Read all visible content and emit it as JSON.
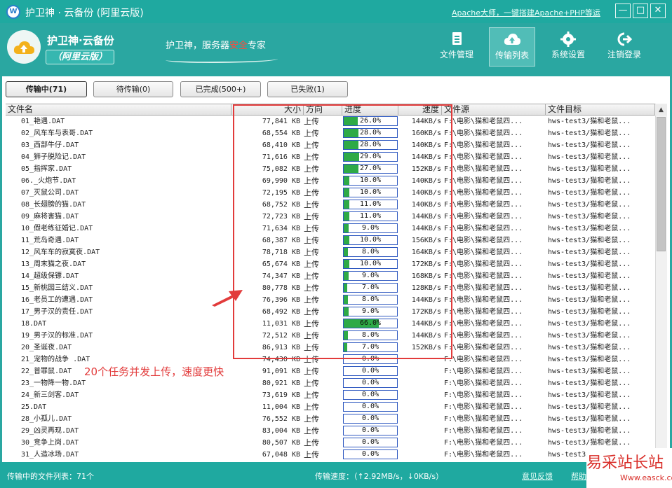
{
  "window": {
    "title": "护卫神 · 云备份 (阿里云版)",
    "top_link": "Apache大师，一键搭建Apache+PHP等运",
    "controls": [
      "—",
      "□",
      "✕"
    ]
  },
  "brand": {
    "name": "护卫神·云备份",
    "edition": "（阿里云版）",
    "slogan_prefix": "护卫神，服务器",
    "slogan_highlight": "安全",
    "slogan_suffix": "专家"
  },
  "nav": [
    {
      "label": "文件管理",
      "icon": "file-icon",
      "active": false
    },
    {
      "label": "传输列表",
      "icon": "cloud-upload-icon",
      "active": true
    },
    {
      "label": "系统设置",
      "icon": "gear-icon",
      "active": false
    },
    {
      "label": "注销登录",
      "icon": "logout-icon",
      "active": false
    }
  ],
  "tabs": [
    {
      "label": "传输中(71)",
      "active": true
    },
    {
      "label": "待传输(0)",
      "active": false
    },
    {
      "label": "已完成(500+)",
      "active": false
    },
    {
      "label": "已失败(1)",
      "active": false
    }
  ],
  "columns": [
    "文件名",
    "大小",
    "方向",
    "进度",
    "速度",
    "文件源",
    "文件目标"
  ],
  "rows": [
    {
      "name": "01_艳遇.DAT",
      "size": "77,841 KB",
      "dir": "上传",
      "progress": 26.0,
      "progress_text": "26.0%",
      "speed": "144KB/s",
      "src": "F:\\电影\\猫和老鼠四...",
      "dst": "hws-test3/猫和老鼠..."
    },
    {
      "name": "02_风车车与表哥.DAT",
      "size": "68,554 KB",
      "dir": "上传",
      "progress": 28.0,
      "progress_text": "28.0%",
      "speed": "160KB/s",
      "src": "F:\\电影\\猫和老鼠四...",
      "dst": "hws-test3/猫和老鼠..."
    },
    {
      "name": "03_西部牛仔.DAT",
      "size": "68,410 KB",
      "dir": "上传",
      "progress": 28.0,
      "progress_text": "28.0%",
      "speed": "140KB/s",
      "src": "F:\\电影\\猫和老鼠四...",
      "dst": "hws-test3/猫和老鼠..."
    },
    {
      "name": "04_狮子脱险记.DAT",
      "size": "71,616 KB",
      "dir": "上传",
      "progress": 29.0,
      "progress_text": "29.0%",
      "speed": "144KB/s",
      "src": "F:\\电影\\猫和老鼠四...",
      "dst": "hws-test3/猫和老鼠..."
    },
    {
      "name": "05_指挥家.DAT",
      "size": "75,082 KB",
      "dir": "上传",
      "progress": 27.0,
      "progress_text": "27.0%",
      "speed": "152KB/s",
      "src": "F:\\电影\\猫和老鼠四...",
      "dst": "hws-test3/猫和老鼠..."
    },
    {
      "name": "06._火炮节.DAT",
      "size": "69,990 KB",
      "dir": "上传",
      "progress": 10.0,
      "progress_text": "10.0%",
      "speed": "140KB/s",
      "src": "F:\\电影\\猫和老鼠四...",
      "dst": "hws-test3/猫和老鼠..."
    },
    {
      "name": "07_灭鼠公司.DAT",
      "size": "72,195 KB",
      "dir": "上传",
      "progress": 10.0,
      "progress_text": "10.0%",
      "speed": "140KB/s",
      "src": "F:\\电影\\猫和老鼠四...",
      "dst": "hws-test3/猫和老鼠..."
    },
    {
      "name": "08_长翅膀的猫.DAT",
      "size": "68,752 KB",
      "dir": "上传",
      "progress": 11.0,
      "progress_text": "11.0%",
      "speed": "140KB/s",
      "src": "F:\\电影\\猫和老鼠四...",
      "dst": "hws-test3/猫和老鼠..."
    },
    {
      "name": "09_麻将害猫.DAT",
      "size": "72,723 KB",
      "dir": "上传",
      "progress": 11.0,
      "progress_text": "11.0%",
      "speed": "144KB/s",
      "src": "F:\\电影\\猫和老鼠四...",
      "dst": "hws-test3/猫和老鼠..."
    },
    {
      "name": "10_假老练征婚记.DAT",
      "size": "71,634 KB",
      "dir": "上传",
      "progress": 9.0,
      "progress_text": "9.0%",
      "speed": "144KB/s",
      "src": "F:\\电影\\猫和老鼠四...",
      "dst": "hws-test3/猫和老鼠..."
    },
    {
      "name": "11_荒岛奇遇.DAT",
      "size": "68,387 KB",
      "dir": "上传",
      "progress": 10.0,
      "progress_text": "10.0%",
      "speed": "156KB/s",
      "src": "F:\\电影\\猫和老鼠四...",
      "dst": "hws-test3/猫和老鼠..."
    },
    {
      "name": "12_风车车的寂寞夜.DAT",
      "size": "78,718 KB",
      "dir": "上传",
      "progress": 8.0,
      "progress_text": "8.0%",
      "speed": "164KB/s",
      "src": "F:\\电影\\猫和老鼠四...",
      "dst": "hws-test3/猫和老鼠..."
    },
    {
      "name": "13_周末猫之夜.DAT",
      "size": "65,674 KB",
      "dir": "上传",
      "progress": 10.0,
      "progress_text": "10.0%",
      "speed": "172KB/s",
      "src": "F:\\电影\\猫和老鼠四...",
      "dst": "hws-test3/猫和老鼠..."
    },
    {
      "name": "14_超级保镖.DAT",
      "size": "74,347 KB",
      "dir": "上传",
      "progress": 9.0,
      "progress_text": "9.0%",
      "speed": "168KB/s",
      "src": "F:\\电影\\猫和老鼠四...",
      "dst": "hws-test3/猫和老鼠..."
    },
    {
      "name": "15_新桃园三结义.DAT",
      "size": "80,778 KB",
      "dir": "上传",
      "progress": 7.0,
      "progress_text": "7.0%",
      "speed": "128KB/s",
      "src": "F:\\电影\\猫和老鼠四...",
      "dst": "hws-test3/猫和老鼠..."
    },
    {
      "name": "16_老员工的遭遇.DAT",
      "size": "76,396 KB",
      "dir": "上传",
      "progress": 8.0,
      "progress_text": "8.0%",
      "speed": "144KB/s",
      "src": "F:\\电影\\猫和老鼠四...",
      "dst": "hws-test3/猫和老鼠..."
    },
    {
      "name": "17_男子汉的责任.DAT",
      "size": "68,492 KB",
      "dir": "上传",
      "progress": 9.0,
      "progress_text": "9.0%",
      "speed": "172KB/s",
      "src": "F:\\电影\\猫和老鼠四...",
      "dst": "hws-test3/猫和老鼠..."
    },
    {
      "name": "18.DAT",
      "size": "11,031 KB",
      "dir": "上传",
      "progress": 66.0,
      "progress_text": "66.0%",
      "speed": "144KB/s",
      "src": "F:\\电影\\猫和老鼠四...",
      "dst": "hws-test3/猫和老鼠..."
    },
    {
      "name": "19_男子汉的标准.DAT",
      "size": "72,512 KB",
      "dir": "上传",
      "progress": 8.0,
      "progress_text": "8.0%",
      "speed": "144KB/s",
      "src": "F:\\电影\\猫和老鼠四...",
      "dst": "hws-test3/猫和老鼠..."
    },
    {
      "name": "20_圣诞夜.DAT",
      "size": "86,913 KB",
      "dir": "上传",
      "progress": 7.0,
      "progress_text": "7.0%",
      "speed": "152KB/s",
      "src": "F:\\电影\\猫和老鼠四...",
      "dst": "hws-test3/猫和老鼠..."
    },
    {
      "name": "21_宠物的战争 .DAT",
      "size": "74,430 KB",
      "dir": "上传",
      "progress": 0.0,
      "progress_text": "0.0%",
      "speed": "",
      "src": "F:\\电影\\猫和老鼠四...",
      "dst": "hws-test3/猫和老鼠..."
    },
    {
      "name": "22_普罪鼠.DAT",
      "size": "91,091 KB",
      "dir": "上传",
      "progress": 0.0,
      "progress_text": "0.0%",
      "speed": "",
      "src": "F:\\电影\\猫和老鼠四...",
      "dst": "hws-test3/猫和老鼠..."
    },
    {
      "name": "23_一物降一物.DAT",
      "size": "80,921 KB",
      "dir": "上传",
      "progress": 0.0,
      "progress_text": "0.0%",
      "speed": "",
      "src": "F:\\电影\\猫和老鼠四...",
      "dst": "hws-test3/猫和老鼠..."
    },
    {
      "name": "24_新三剑客.DAT",
      "size": "73,619 KB",
      "dir": "上传",
      "progress": 0.0,
      "progress_text": "0.0%",
      "speed": "",
      "src": "F:\\电影\\猫和老鼠四...",
      "dst": "hws-test3/猫和老鼠..."
    },
    {
      "name": "25.DAT",
      "size": "11,004 KB",
      "dir": "上传",
      "progress": 0.0,
      "progress_text": "0.0%",
      "speed": "",
      "src": "F:\\电影\\猫和老鼠四...",
      "dst": "hws-test3/猫和老鼠..."
    },
    {
      "name": "28_小孤儿.DAT",
      "size": "76,552 KB",
      "dir": "上传",
      "progress": 0.0,
      "progress_text": "0.0%",
      "speed": "",
      "src": "F:\\电影\\猫和老鼠四...",
      "dst": "hws-test3/猫和老鼠..."
    },
    {
      "name": "29_凶灵再现.DAT",
      "size": "83,004 KB",
      "dir": "上传",
      "progress": 0.0,
      "progress_text": "0.0%",
      "speed": "",
      "src": "F:\\电影\\猫和老鼠四...",
      "dst": "hws-test3/猫和老鼠..."
    },
    {
      "name": "30_竞争上岗.DAT",
      "size": "80,507 KB",
      "dir": "上传",
      "progress": 0.0,
      "progress_text": "0.0%",
      "speed": "",
      "src": "F:\\电影\\猫和老鼠四...",
      "dst": "hws-test3/猫和老鼠..."
    },
    {
      "name": "31_人造冰场.DAT",
      "size": "67,048 KB",
      "dir": "上传",
      "progress": 0.0,
      "progress_text": "0.0%",
      "speed": "",
      "src": "F:\\电影\\猫和老鼠四...",
      "dst": "hws-test3/猫和老鼠..."
    }
  ],
  "annotation": {
    "text": "20个任务并发上传，速度更快",
    "color": "#e23b3b"
  },
  "status": {
    "left": "传输中的文件列表：71个",
    "middle": "传输速度：（↑2.92MB/s，↓0KB/s）",
    "feedback": "意见反馈",
    "help": "帮助"
  },
  "watermark": {
    "main": "易采站长站",
    "sub": "Www.easck.com"
  },
  "colors": {
    "accent": "#1fa9a0",
    "progress_fill": "#2eaa46",
    "progress_border": "#2e58c0"
  }
}
